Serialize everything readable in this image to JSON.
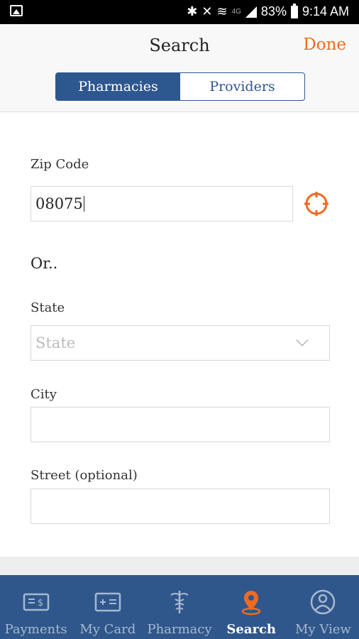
{
  "status_bar": {
    "battery": "83%",
    "time": "9:14 AM",
    "network": "4G"
  },
  "header": {
    "title": "Search",
    "done_label": "Done",
    "segments": [
      {
        "label": "Pharmacies",
        "active": true
      },
      {
        "label": "Providers",
        "active": false
      }
    ]
  },
  "form": {
    "zip": {
      "label": "Zip Code",
      "value": "08075"
    },
    "or_text": "Or..",
    "state": {
      "label": "State",
      "placeholder": "State"
    },
    "city": {
      "label": "City",
      "value": ""
    },
    "street": {
      "label": "Street (optional)",
      "value": ""
    }
  },
  "bottom_nav": {
    "items": [
      {
        "label": "Payments",
        "icon": "payments-icon",
        "active": false
      },
      {
        "label": "My Card",
        "icon": "card-icon",
        "active": false
      },
      {
        "label": "Pharmacy",
        "icon": "caduceus-icon",
        "active": false
      },
      {
        "label": "Search",
        "icon": "location-pin-icon",
        "active": true
      },
      {
        "label": "My View",
        "icon": "profile-icon",
        "active": false
      }
    ]
  },
  "colors": {
    "brand_blue": "#2f578c",
    "accent_orange": "#ef6a21"
  }
}
